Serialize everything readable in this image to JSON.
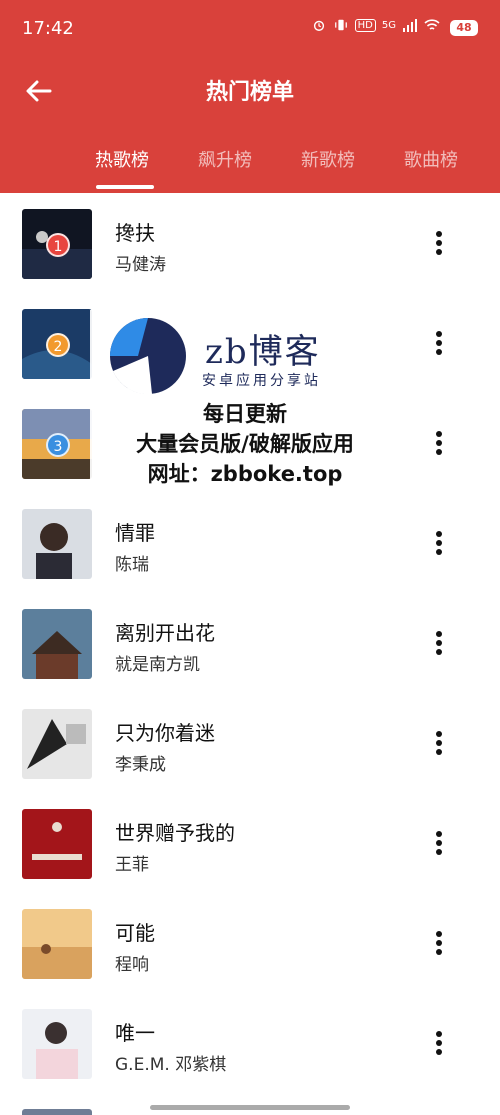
{
  "status_bar": {
    "time": "17:42",
    "network": "5G",
    "hd": "HD",
    "battery": "48"
  },
  "header": {
    "title": "热门榜单"
  },
  "tabs": [
    {
      "label": "热歌榜",
      "active": true
    },
    {
      "label": "飙升榜",
      "active": false
    },
    {
      "label": "新歌榜",
      "active": false
    },
    {
      "label": "歌曲榜",
      "active": false
    }
  ],
  "songs": [
    {
      "rank": "1",
      "title": "搀扶",
      "artist": "马健涛"
    },
    {
      "rank": "2",
      "title": "",
      "artist": ""
    },
    {
      "rank": "3",
      "title": "",
      "artist": ""
    },
    {
      "rank": "",
      "title": "情罪",
      "artist": "陈瑞"
    },
    {
      "rank": "",
      "title": "离别开出花",
      "artist": "就是南方凯"
    },
    {
      "rank": "",
      "title": "只为你着迷",
      "artist": "李秉成"
    },
    {
      "rank": "",
      "title": "世界赠予我的",
      "artist": "王菲"
    },
    {
      "rank": "",
      "title": "可能",
      "artist": "程响"
    },
    {
      "rank": "",
      "title": "唯一",
      "artist": "G.E.M. 邓紫棋"
    }
  ],
  "watermark": {
    "brand": "zb博客",
    "subtitle": "安卓应用分享站",
    "line1": "每日更新",
    "line2": "大量会员版/破解版应用",
    "line3": "网址：zbboke.top"
  },
  "colors": {
    "accent": "#d9413b",
    "rank1": "#e8463f",
    "rank2": "#f29a2e",
    "rank3": "#3a8fe0"
  }
}
